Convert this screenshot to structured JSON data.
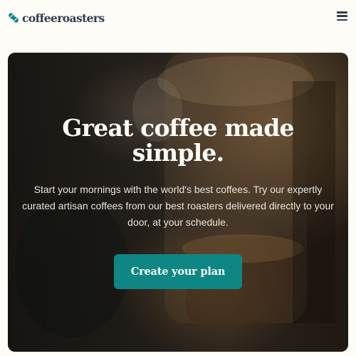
{
  "header": {
    "brand": "coffeeroasters",
    "menu_icon": "hamburger-menu-icon",
    "logo_icon": "coffee-beans-icon"
  },
  "hero": {
    "title": "Great coffee made simple.",
    "description": "Start your mornings with the world's best coffees. Try our expertly curated artisan coffees from our best roasters delivered directly to your door, at your schedule.",
    "cta_label": "Create your plan"
  },
  "colors": {
    "accent": "#0e8784",
    "dark_text": "#333d4b",
    "background": "#fefcf7"
  }
}
